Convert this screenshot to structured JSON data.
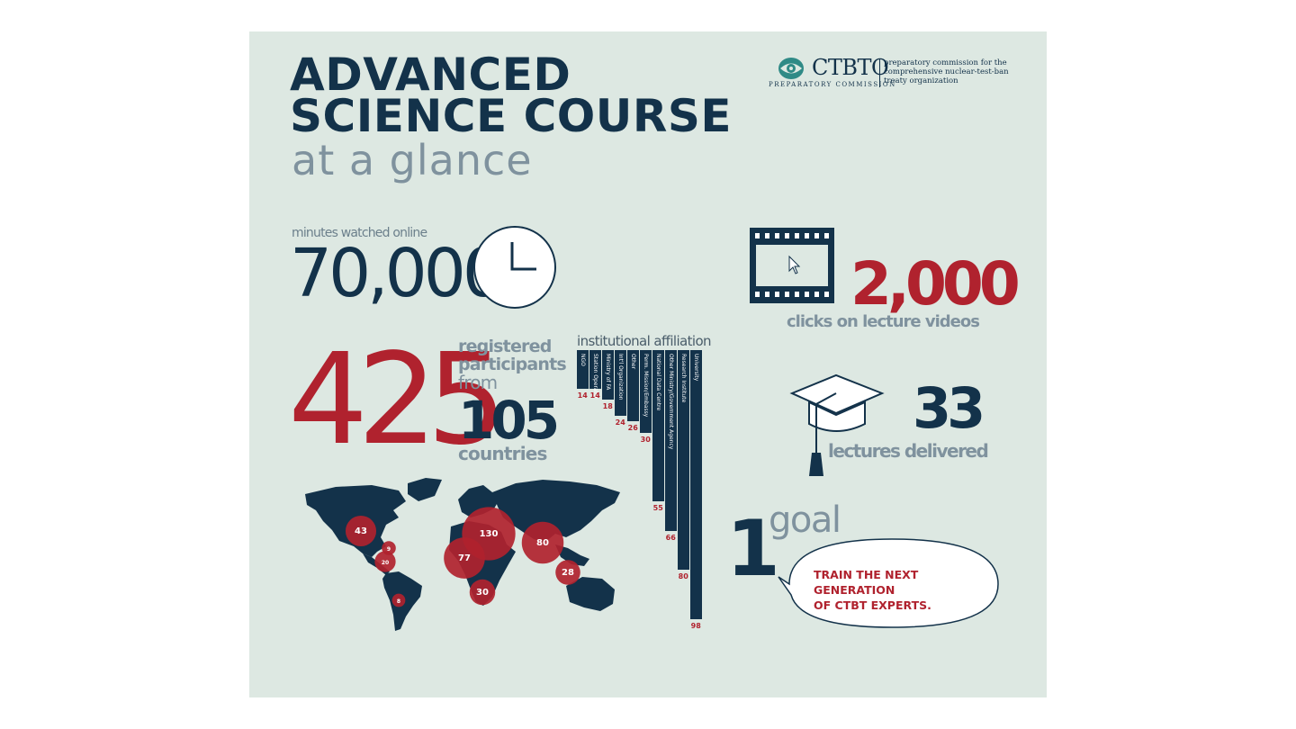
{
  "title": {
    "line1": "ADVANCED",
    "line2": "SCIENCE COURSE",
    "subtitle": "at a glance"
  },
  "logo": {
    "name": "CTBTO",
    "subline": "PREPARATORY COMMISSION",
    "tagline": "preparatory commission for the comprehensive nuclear-test-ban treaty organization"
  },
  "stats": {
    "minutes": {
      "label": "minutes watched online",
      "value": "70,000",
      "icon": "clock-icon"
    },
    "clicks": {
      "value": "2,000",
      "label": "clicks on lecture videos",
      "icon": "film-strip-icon"
    },
    "participants": {
      "value": "425",
      "label1": "registered",
      "label2": "participants",
      "label3": "from",
      "countries_value": "105",
      "countries_label": "countries"
    },
    "lectures": {
      "value": "33",
      "label": "lectures delivered",
      "icon": "graduation-cap-icon"
    },
    "goal": {
      "value": "1",
      "label": "goal",
      "text_line1": "TRAIN THE NEXT GENERATION",
      "text_line2": "OF CTBT EXPERTS."
    }
  },
  "affiliation": {
    "title": "institutional affiliation",
    "items": [
      {
        "label": "NGO",
        "value": "14"
      },
      {
        "label": "Station Operator",
        "value": "14"
      },
      {
        "label": "Ministry of FA",
        "value": "18"
      },
      {
        "label": "Int'l Organization",
        "value": "24"
      },
      {
        "label": "Other",
        "value": "26"
      },
      {
        "label": "Perm. Mission/Embassy",
        "value": "30"
      },
      {
        "label": "National Data Centre",
        "value": "55"
      },
      {
        "label": "Other Ministry/Government Agency",
        "value": "66"
      },
      {
        "label": "Research Institute",
        "value": "80"
      },
      {
        "label": "University",
        "value": "98"
      }
    ]
  },
  "map": {
    "regions": [
      {
        "label": "43",
        "value": 43
      },
      {
        "label": "9",
        "value": 9
      },
      {
        "label": "20",
        "value": 20
      },
      {
        "label": "8",
        "value": 8
      },
      {
        "label": "130",
        "value": 130
      },
      {
        "label": "77",
        "value": 77
      },
      {
        "label": "30",
        "value": 30
      },
      {
        "label": "80",
        "value": 80
      },
      {
        "label": "28",
        "value": 28
      }
    ]
  },
  "colors": {
    "navy": "#13324a",
    "red": "#b0222e",
    "grey": "#7f929e",
    "background": "#dde8e2"
  }
}
